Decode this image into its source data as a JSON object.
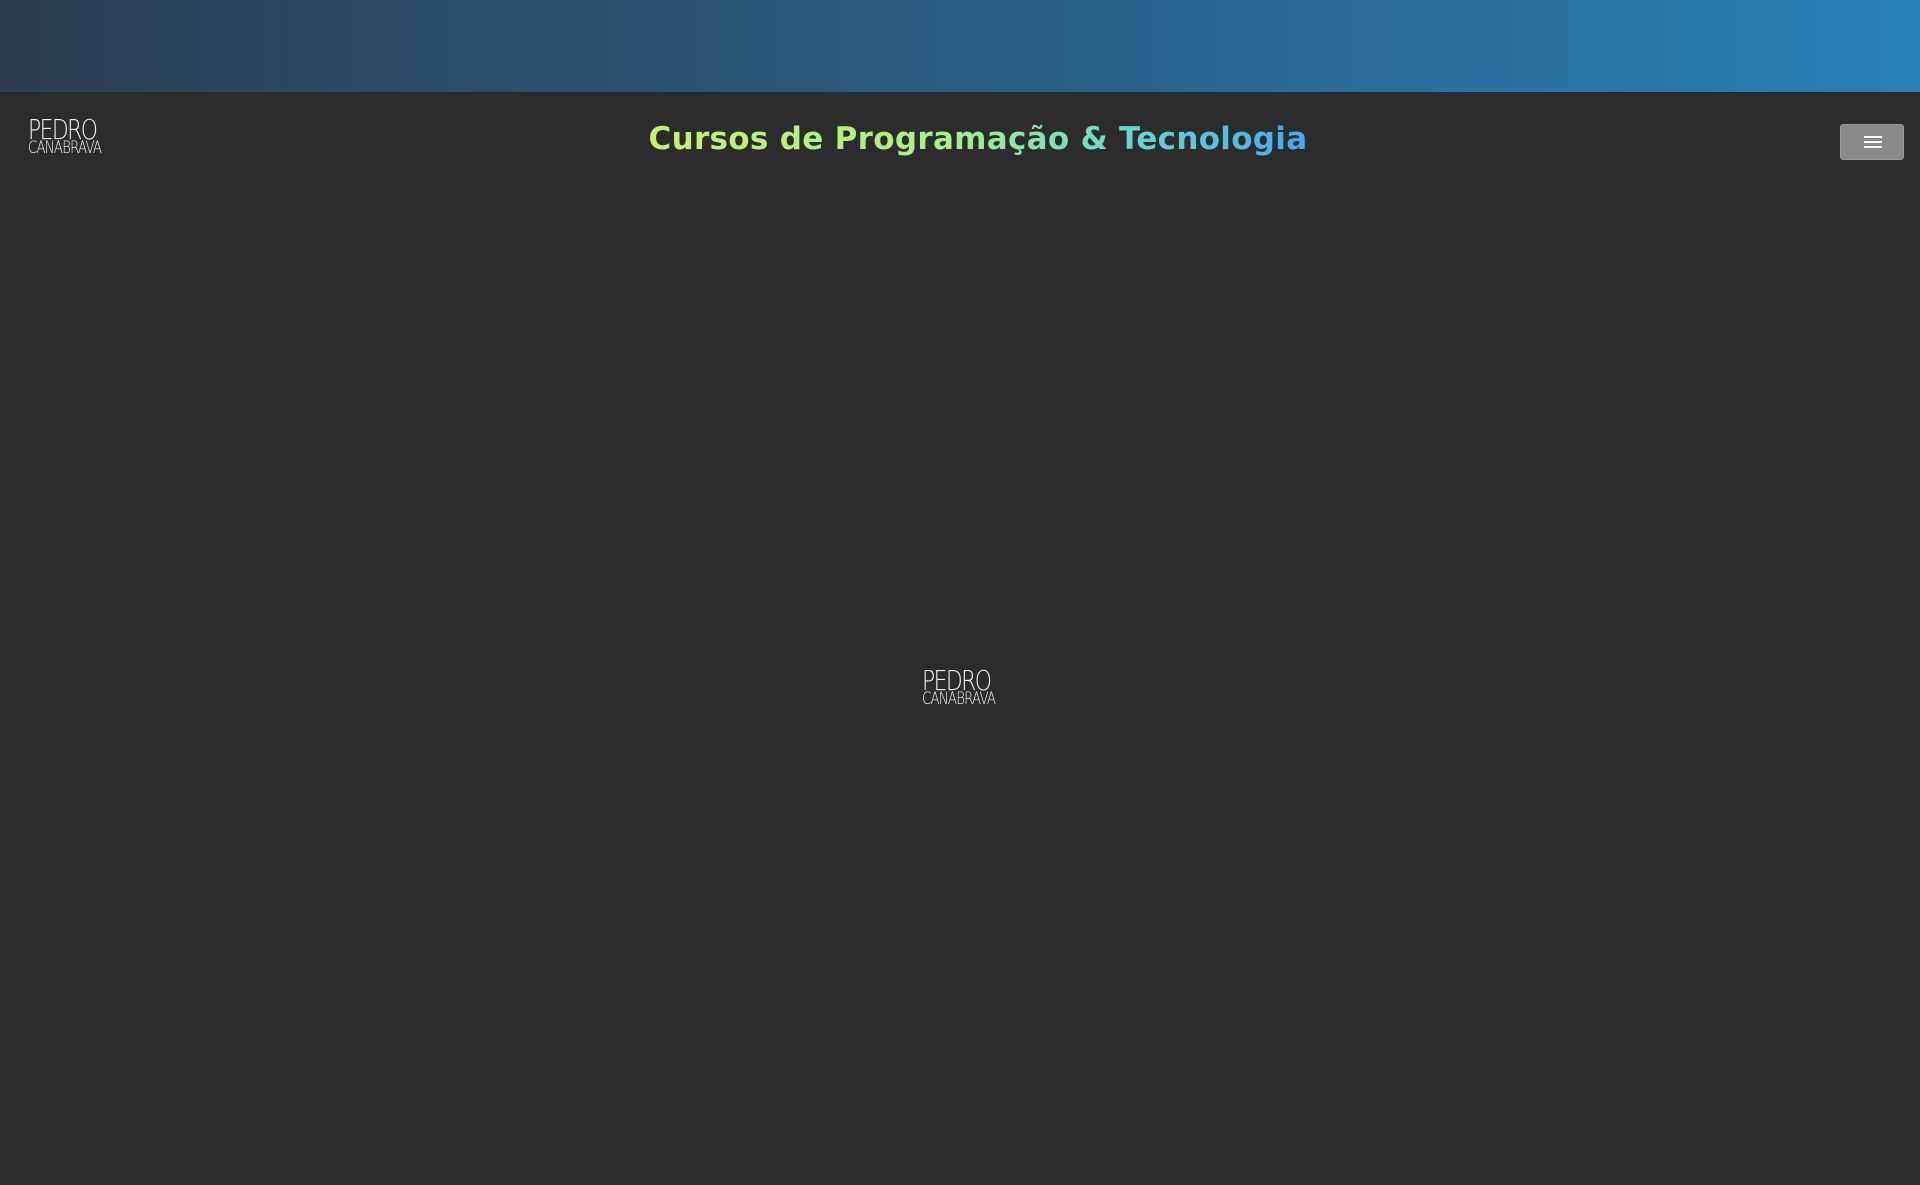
{
  "header": {
    "logo_line1": "PEDRO",
    "logo_line2": "CANABRAVA",
    "title": "Cursos de Programação & Tecnologia",
    "menu_icon": "hamburger-menu-icon"
  },
  "loader": {
    "logo_line1": "PEDRO",
    "logo_line2": "CANABRAVA"
  },
  "colors": {
    "banner_gradient_start": "#2c3e50",
    "banner_gradient_end": "#2980b9",
    "background": "#2c2c2c",
    "title_gradient_start": "#c4f26e",
    "title_gradient_end": "#47a8f0",
    "menu_button": "#8a8a8a"
  }
}
